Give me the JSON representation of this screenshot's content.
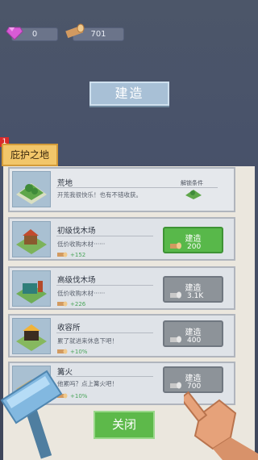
{
  "resources": {
    "gems": "0",
    "wood": "701"
  },
  "title_button": "建造",
  "tab": {
    "badge": "1",
    "label": "庇护之地"
  },
  "wasteland": {
    "name": "荒地",
    "desc": "开荒我很快乐！也有不错收获。",
    "unlock_label": "解锁条件"
  },
  "buildings": [
    {
      "name": "初级伐木场",
      "desc": "低价收购木材······",
      "gain": "+152",
      "button_label": "建造",
      "cost": "200",
      "state": "available"
    },
    {
      "name": "高级伐木场",
      "desc": "低价收购木材······",
      "gain": "+226",
      "button_label": "建造",
      "cost": "3.1K",
      "state": "locked"
    },
    {
      "name": "收容所",
      "desc": "累了就进来休息下吧！",
      "gain": "+10%",
      "button_label": "建造",
      "cost": "400",
      "state": "locked"
    },
    {
      "name": "篝火",
      "desc": "他累吗？点上篝火吧！",
      "gain": "+10%",
      "button_label": "建造",
      "cost": "700",
      "state": "locked"
    }
  ],
  "close_button": "关闭",
  "colors": {
    "accent_green": "#58b84a",
    "disabled_gray": "#8d9399",
    "tab_gold": "#f2c66a"
  }
}
